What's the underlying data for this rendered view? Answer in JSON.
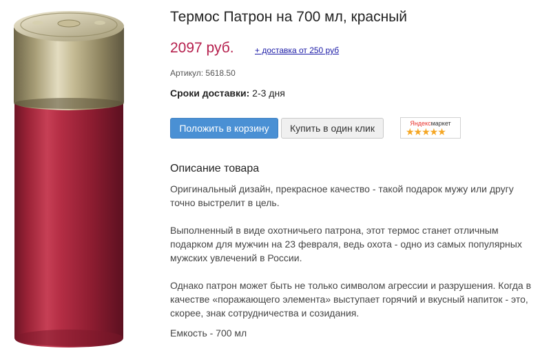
{
  "product": {
    "title": "Термос Патрон на 700 мл, красный",
    "price": "2097 руб.",
    "delivery_link": "+ доставка от 250 руб",
    "article": "Артикул: 5618.50",
    "delivery_terms_label": "Сроки доставки:",
    "delivery_terms_value": " 2-3 дня",
    "image": "red-shotgun-shell-thermos"
  },
  "buttons": {
    "add_to_cart": "Положить в корзину",
    "one_click": "Купить в один клик"
  },
  "badge": {
    "brand_yandex": "Яндекс",
    "brand_market": "маркет",
    "stars": "★★★★★",
    "rating": 5,
    "star_color": "#f5a623"
  },
  "description": {
    "heading": "Описание товара",
    "paragraphs": [
      "Оригинальный дизайн, прекрасное качество - такой подарок мужу или другу точно выстрелит в цель.",
      "Выполненный в виде охотничьего патрона, этот термос станет отличным подарком для мужчин на 23 февраля, ведь охота - одно из самых популярных мужских увлечений в России.",
      "Однако патрон может быть не только символом агрессии и разрушения. Когда в качестве «поражающего элемента» выступает горячий и вкусный напиток - это, скорее, знак сотрудничества и созидания."
    ],
    "capacity": "Емкость - 700 мл"
  },
  "colors": {
    "price": "#b51e4c",
    "primary_button": "#4a90d4",
    "link": "#1a1aa6",
    "thermos_red": "#a5283a",
    "cap_gold": "#b8ad85"
  }
}
